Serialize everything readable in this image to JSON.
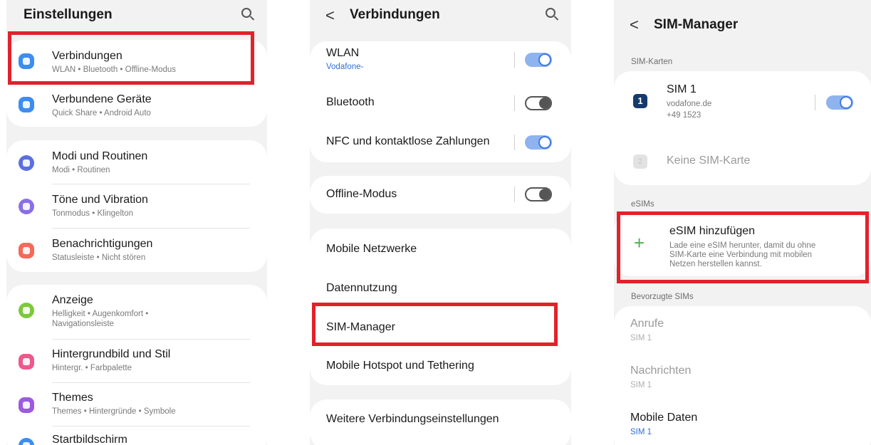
{
  "colors": {
    "accent": "#3e7ae6",
    "highlight": "#e3212b",
    "plus": "#4caf50"
  },
  "screen1": {
    "title": "Einstellungen",
    "search_icon": "search-icon",
    "items": [
      {
        "title": "Verbindungen",
        "subtitle": "WLAN • Bluetooth • Offline-Modus",
        "icon": "wifi-icon",
        "color": "#3d8df0"
      },
      {
        "title": "Verbundene Geräte",
        "subtitle": "Quick Share • Android Auto",
        "icon": "devices-icon",
        "color": "#3d8df0"
      },
      {
        "title": "Modi und Routinen",
        "subtitle": "Modi • Routinen",
        "icon": "check-circle-icon",
        "color": "#5a6fe0"
      },
      {
        "title": "Töne und Vibration",
        "subtitle": "Tonmodus • Klingelton",
        "icon": "speaker-icon",
        "color": "#8a6ee8"
      },
      {
        "title": "Benachrichtigungen",
        "subtitle": "Statusleiste • Nicht stören",
        "icon": "notification-icon",
        "color": "#f26a5a"
      },
      {
        "title": "Anzeige",
        "subtitle": "Helligkeit • Augenkomfort •",
        "subtitle2": "Navigationsleiste",
        "icon": "sun-icon",
        "color": "#7cc83a"
      },
      {
        "title": "Hintergrundbild und Stil",
        "subtitle": "Hintergr. • Farbpalette",
        "icon": "image-icon",
        "color": "#ec5a8a"
      },
      {
        "title": "Themes",
        "subtitle": "Themes • Hintergründe • Symbole",
        "icon": "palette-icon",
        "color": "#9b5ae0"
      },
      {
        "title": "Startbildschirm",
        "icon": "home-icon",
        "color": "#3d8df0"
      }
    ]
  },
  "screen2": {
    "back": "<",
    "title": "Verbindungen",
    "items": [
      {
        "label": "WLAN",
        "sublabel": "Vodafone-",
        "toggle": "on"
      },
      {
        "label": "Bluetooth",
        "toggle": "off"
      },
      {
        "label": "NFC und kontaktlose Zahlungen",
        "toggle": "on"
      },
      {
        "label": "Offline-Modus",
        "toggle": "off"
      },
      {
        "label": "Mobile Netzwerke"
      },
      {
        "label": "Datennutzung"
      },
      {
        "label": "SIM-Manager"
      },
      {
        "label": "Mobile Hotspot und Tethering"
      },
      {
        "label": "Weitere Verbindungseinstellungen"
      }
    ]
  },
  "screen3": {
    "back": "<",
    "title": "SIM-Manager",
    "sim_section": "SIM-Karten",
    "sim1": {
      "badge": "1",
      "name": "SIM 1",
      "carrier": "vodafone.de",
      "number": "+49 1523",
      "toggle": "on"
    },
    "sim2": {
      "badge": "2",
      "name": "Keine SIM-Karte"
    },
    "esim_section": "eSIMs",
    "esim_add": {
      "plus": "+",
      "title": "eSIM hinzufügen",
      "desc1": "Lade eine eSIM herunter, damit du ohne",
      "desc2": "SIM-Karte eine Verbindung mit mobilen",
      "desc3": "Netzen herstellen kannst."
    },
    "preferred_section": "Bevorzugte SIMs",
    "preferred": [
      {
        "title": "Anrufe",
        "value": "SIM 1"
      },
      {
        "title": "Nachrichten",
        "value": "SIM 1"
      },
      {
        "title": "Mobile Daten",
        "value": "SIM 1"
      }
    ]
  }
}
